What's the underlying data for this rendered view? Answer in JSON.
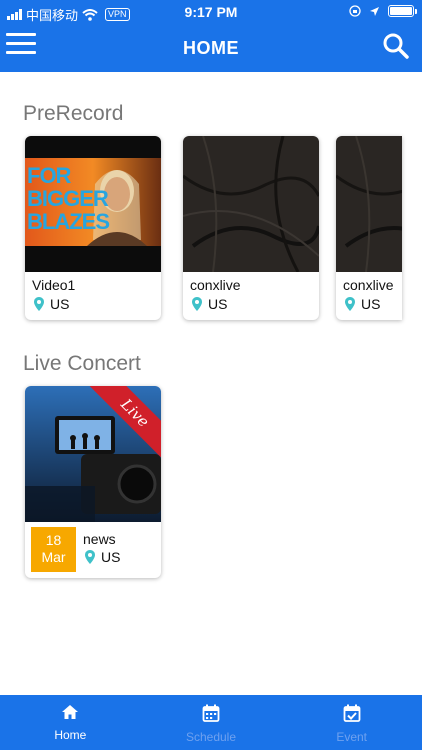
{
  "status_bar": {
    "carrier": "中国移动",
    "vpn": "VPN",
    "time": "9:17 PM"
  },
  "header": {
    "title": "HOME",
    "menu_icon": "hamburger-menu-icon",
    "search_icon": "search-icon"
  },
  "sections": [
    {
      "title": "PreRecord",
      "cards": [
        {
          "title": "Video1",
          "location": "US",
          "thumb_text": "FOR BIGGER BLAZES"
        },
        {
          "title": "conxlive",
          "location": "US"
        },
        {
          "title": "conxlive",
          "location": "US"
        }
      ]
    },
    {
      "title": "Live Concert",
      "cards": [
        {
          "title": "news",
          "location": "US",
          "badge": "Live",
          "date_day": "18",
          "date_month": "Mar"
        }
      ]
    }
  ],
  "bottom_nav": {
    "items": [
      {
        "label": "Home",
        "icon": "home-icon",
        "active": true
      },
      {
        "label": "Schedule",
        "icon": "calendar-icon",
        "active": false
      },
      {
        "label": "Event",
        "icon": "calendar-check-icon",
        "active": false
      }
    ]
  },
  "colors": {
    "primary": "#1a73e8",
    "date_badge": "#f7a800",
    "live_ribbon": "#d0202a",
    "pin": "#3fc1c9",
    "nav_inactive": "#6fa1ef"
  }
}
